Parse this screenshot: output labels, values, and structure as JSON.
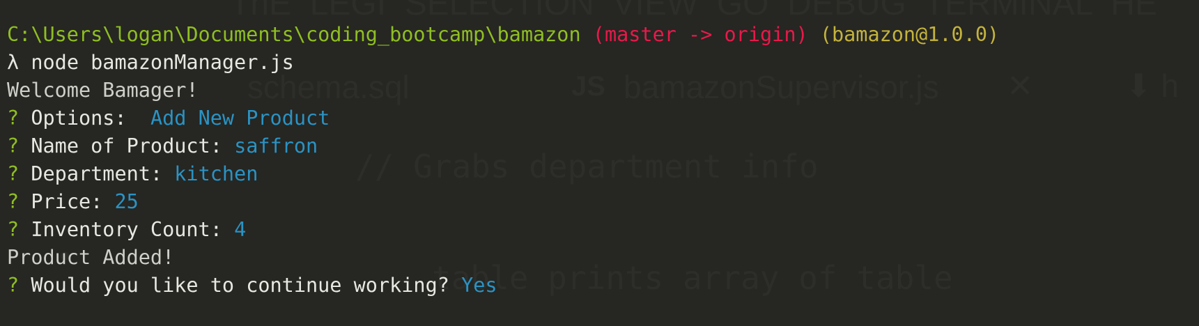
{
  "ghost_text": {
    "top": "ThE  LEGI  SELECTION  VIEW  GO  DEBUG  TERMINAL  HE",
    "tab1": "schema.sql",
    "js_badge": "JS",
    "tab2": "bamazonSupervisor.js",
    "tab_close": "✕",
    "tab_arrow": "⬇ h",
    "comment1": "// Grabs department info",
    "comment2": "table prints array of table",
    "dot": "•"
  },
  "prompt": {
    "path": "C:\\Users\\logan\\Documents\\coding_bootcamp\\bamazon",
    "git": "(master -> origin)",
    "package": "(bamazon@1.0.0)"
  },
  "command": {
    "lambda": "λ",
    "text": "node bamazonManager.js"
  },
  "output": {
    "welcome": "Welcome Bamager!",
    "product_added": "Product Added!"
  },
  "questions": [
    {
      "mark": "?",
      "label": "Options: ",
      "answer": "Add New Product"
    },
    {
      "mark": "?",
      "label": "Name of Product:",
      "answer": "saffron"
    },
    {
      "mark": "?",
      "label": "Department:",
      "answer": "kitchen"
    },
    {
      "mark": "?",
      "label": "Price:",
      "answer": "25"
    },
    {
      "mark": "?",
      "label": "Inventory Count:",
      "answer": "4"
    },
    {
      "mark": "?",
      "label": "Would you like to continue working?",
      "answer": "Yes"
    }
  ],
  "colors": {
    "background": "#262622",
    "path": "#8fbf21",
    "git": "#e8194a",
    "package": "#c4b33c",
    "answer": "#2a93c4"
  }
}
